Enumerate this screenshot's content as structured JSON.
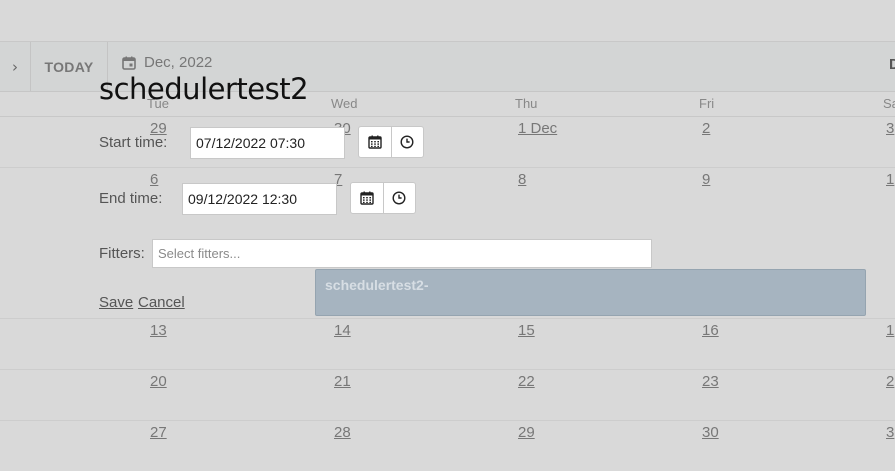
{
  "toolbar": {
    "next_glyph": "›",
    "today_label": "TODAY",
    "date_label": "Dec, 2022",
    "right_edge_letter": "D"
  },
  "calendar": {
    "day_names": [
      "Tue",
      "Wed",
      "Thu",
      "Fri",
      "Sa"
    ],
    "weeks": [
      [
        "29",
        "30",
        "1 Dec",
        "2",
        "3"
      ],
      [
        "6",
        "7",
        "8",
        "9",
        "1"
      ],
      [
        "",
        "",
        "",
        "",
        ""
      ],
      [
        "13",
        "14",
        "15",
        "16",
        "1"
      ],
      [
        "20",
        "21",
        "22",
        "23",
        "2"
      ],
      [
        "27",
        "28",
        "29",
        "30",
        "3"
      ]
    ],
    "event": {
      "title": "schedulertest2-"
    }
  },
  "dialog": {
    "title": "schedulertest2",
    "start_label": "Start time:",
    "start_value": "07/12/2022 07:30",
    "end_label": "End time:",
    "end_value": "09/12/2022 12:30",
    "fitters_label": "Fitters:",
    "fitters_placeholder": "Select fitters...",
    "save_label": "Save",
    "cancel_label": "Cancel"
  },
  "icons": {
    "calendar": "calendar-icon",
    "clock": "clock-icon"
  }
}
